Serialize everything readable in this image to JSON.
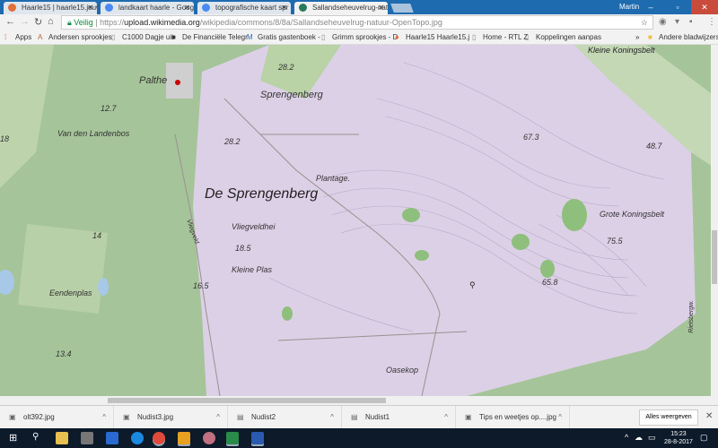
{
  "browser": {
    "tabs": [
      {
        "title": "Haarle15 | haarle15.jouw",
        "icon": "chrome-icon",
        "color": "#e0703a"
      },
      {
        "title": "landkaart haarle - Goog",
        "icon": "google-icon",
        "color": "#4a8af4"
      },
      {
        "title": "topografische kaart spr",
        "icon": "google-icon",
        "color": "#4a8af4"
      },
      {
        "title": "Sallandseheuvelrug-natu",
        "icon": "wikimedia-icon",
        "color": "#2a7a5a"
      }
    ],
    "user": "Martin",
    "address": {
      "security": "Veilig",
      "scheme": "https://",
      "host": "upload.wikimedia.org",
      "path": "/wikipedia/commons/8/8a/Sallandseheuvelrug-natuur-OpenTopo.jpg"
    },
    "bookmarks": [
      "Apps",
      "Andersen sprookjes",
      "C1000 Dagje uit",
      "De Financiële Telegr",
      "Gratis gastenboek -",
      "Grimm sprookjes - D",
      "Haarle15 Haarle15.j",
      "Home - RTL Z",
      "Koppelingen aanpas"
    ],
    "bookmarks_more": "»",
    "other_bookmarks": "Andere bladwijzers"
  },
  "map": {
    "labels": {
      "palthe": "Palthe",
      "h282a": "28.2",
      "sprengenberg": "Sprengenberg",
      "h127": "12.7",
      "landenbos": "Van den Landenbos",
      "h282b": "28.2",
      "desprengenberg": "De Sprengenberg",
      "plantage": "Plantage.",
      "vliegveldhei": "Vliegveldhei",
      "h185": "18.5",
      "kleineplas": "Kleine Plas",
      "h14": "14",
      "h165": "16.5",
      "eendenplas": "Eendenplas",
      "h134": "13.4",
      "oasekop": "Oasekop",
      "h673": "67.3",
      "h487": "48.7",
      "grote": "Grote Koningsbelt",
      "h755": "75.5",
      "h658": "65.8",
      "kleine": "Kleine Koningsbelt",
      "h18": "18",
      "vliegveld": "Vliegveld",
      "rietsberg": "Rietsbergw."
    }
  },
  "downloads": {
    "items": [
      "olt392.jpg",
      "Nudist3.jpg",
      "Nudist2",
      "Nudist1",
      "Tips en weetjes op....jpg"
    ],
    "show_all": "Alles weergeven"
  },
  "taskbar": {
    "time": "15:23",
    "date": "28-8-2017"
  }
}
